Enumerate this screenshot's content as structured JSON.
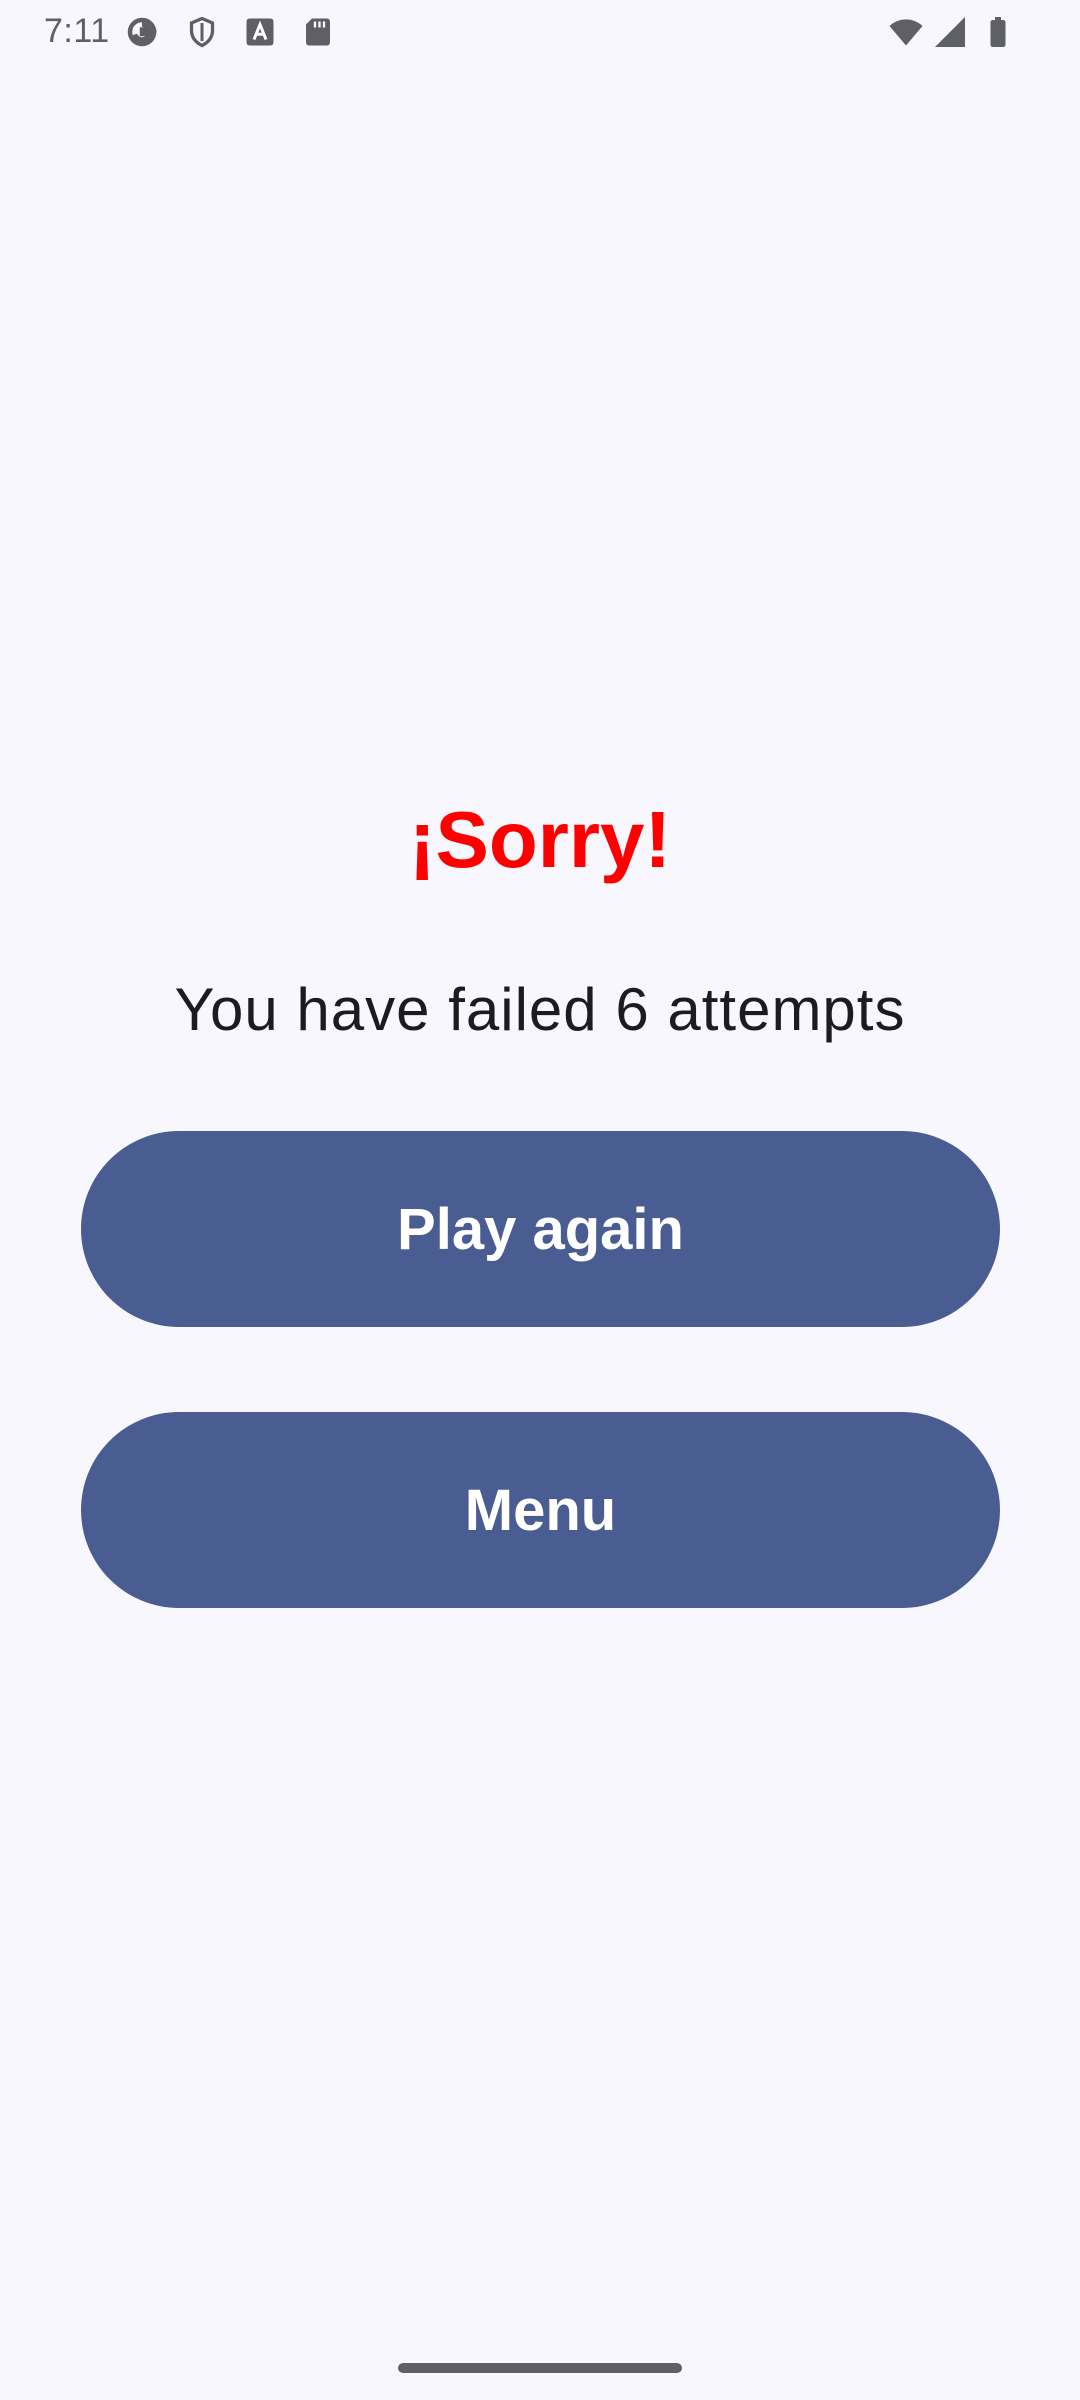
{
  "status_bar": {
    "time": "7:11",
    "icons": [
      "google-icon",
      "shield-icon",
      "font-a-icon",
      "sd-card-icon",
      "wifi-icon",
      "signal-icon",
      "battery-icon"
    ]
  },
  "game_over": {
    "title": "¡Sorry!",
    "message": "You have failed 6 attempts",
    "play_again_label": "Play again",
    "menu_label": "Menu"
  },
  "colors": {
    "background": "#f8f7fd",
    "title": "#ff0000",
    "button": "#4a5d92",
    "button_text": "#ffffff",
    "text": "#1c1b1f"
  }
}
